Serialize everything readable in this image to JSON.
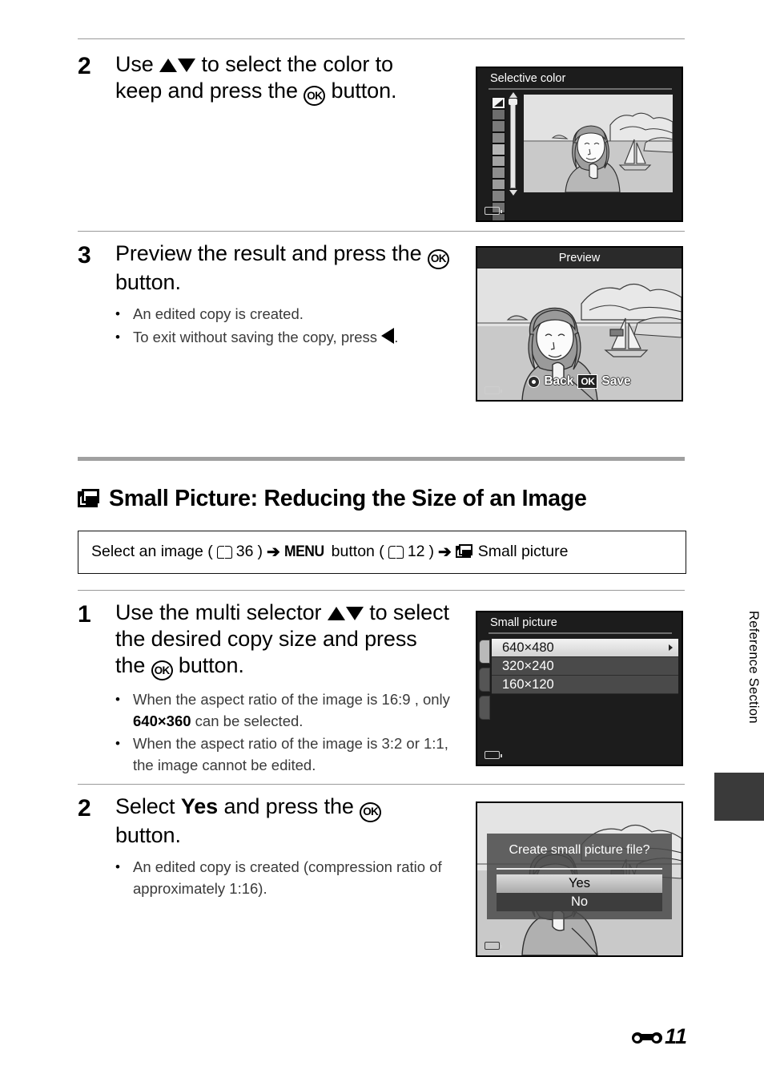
{
  "page": {
    "number": "11",
    "section_label": "Reference Section",
    "page_prefix_icon": "e-reference-icon"
  },
  "steps_selective_color": [
    {
      "number": "2",
      "head_parts": {
        "p1": "Use ",
        "p2": " to select the color to keep and press the ",
        "p3": " button."
      },
      "bullets": []
    },
    {
      "number": "3",
      "head_parts": {
        "p1": "Preview the result and press the ",
        "p2": " button."
      },
      "bullets": [
        {
          "text": "An edited copy is created."
        },
        {
          "pre": "To exit without saving the copy, press ",
          "post": "."
        }
      ]
    }
  ],
  "section": {
    "title": "Small Picture: Reducing the Size of an Image",
    "icon": "small-picture-icon",
    "nav": {
      "part1": "Select an image (",
      "ref1": "36",
      "part2": ") ",
      "menu_label": "MENU",
      "part3": " button (",
      "ref2": "12",
      "part4": ") ",
      "part5": "Small picture",
      "arrow": "➔"
    }
  },
  "steps_small_picture": [
    {
      "number": "1",
      "head_parts": {
        "p1": "Use the multi selector ",
        "p2": " to select the desired copy size and press the ",
        "p3": " button."
      },
      "bullets": [
        {
          "pre": "When the aspect ratio of the image is 16:9 , only ",
          "bold": "640×360",
          "post": " can be selected."
        },
        {
          "text": "When the aspect ratio of the image is 3:2 or 1:1, the image cannot be edited."
        }
      ]
    },
    {
      "number": "2",
      "head_parts": {
        "p1": "Select ",
        "bold": "Yes",
        "p2": " and press the ",
        "p3": " button."
      },
      "bullets": [
        {
          "text": "An edited copy is created (compression ratio of approximately 1:16)."
        }
      ]
    }
  ],
  "screens": {
    "selective_color": {
      "title": "Selective color",
      "battery_icon": "battery-icon",
      "swatch_count": 12,
      "selected_swatch_index": 0
    },
    "preview": {
      "title": "Preview",
      "back_label": "Back",
      "ok_label": "OK",
      "save_label": "Save",
      "multi_selector_icon": "multi-selector-icon",
      "battery_icon": "battery-icon"
    },
    "small_picture_menu": {
      "title": "Small picture",
      "options": [
        "640×480",
        "320×240",
        "160×120"
      ],
      "selected_index": 0,
      "battery_icon": "battery-icon"
    },
    "confirm_dialog": {
      "message": "Create small picture file?",
      "options": [
        "Yes",
        "No"
      ],
      "selected_index": 0,
      "battery_icon": "battery-icon"
    }
  },
  "colors": {
    "rule": "#9a9a9a",
    "thick_rule": "#a0a0a0",
    "screen_bg": "#1c1c1c",
    "menu_row": "#4a4a4a",
    "selected_row": "#e0e0e0",
    "side_tab": "#3a3a3a"
  }
}
